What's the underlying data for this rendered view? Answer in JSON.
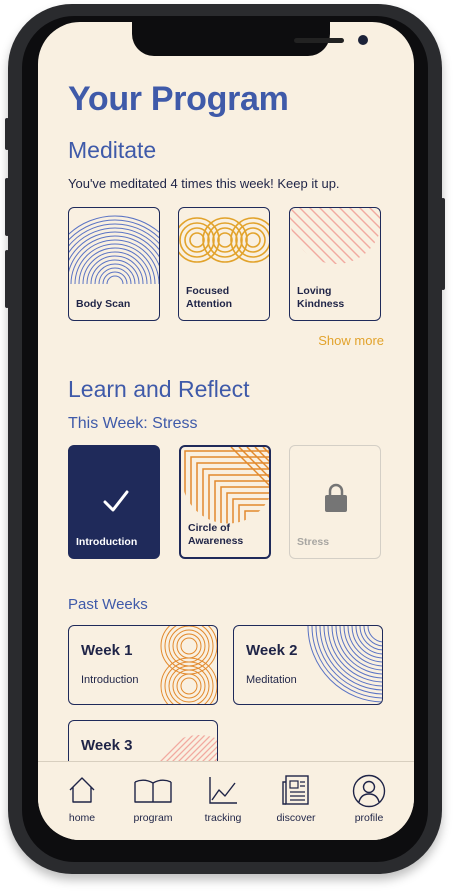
{
  "page": {
    "title": "Your Program"
  },
  "meditate": {
    "heading": "Meditate",
    "message": "You've meditated 4 times this week! Keep it up.",
    "cards": [
      {
        "label": "Body Scan"
      },
      {
        "label": "Focused\nAttention"
      },
      {
        "label": "Loving\nKindness"
      }
    ],
    "show_more": "Show more"
  },
  "learn": {
    "heading": "Learn and Reflect",
    "subheading": "This Week: Stress",
    "cards": [
      {
        "label": "Introduction",
        "state": "completed"
      },
      {
        "label": "Circle of\nAwareness",
        "state": "current"
      },
      {
        "label": "Stress",
        "state": "locked"
      }
    ]
  },
  "past_weeks": {
    "heading": "Past Weeks",
    "weeks": [
      {
        "title": "Week 1",
        "subtitle": "Introduction"
      },
      {
        "title": "Week 2",
        "subtitle": "Meditation"
      },
      {
        "title": "Week 3",
        "subtitle": ""
      }
    ]
  },
  "tabbar": {
    "items": [
      {
        "label": "home",
        "icon": "house-icon"
      },
      {
        "label": "program",
        "icon": "open-book-icon"
      },
      {
        "label": "tracking",
        "icon": "line-chart-icon"
      },
      {
        "label": "discover",
        "icon": "newspaper-icon"
      },
      {
        "label": "profile",
        "icon": "person-icon"
      }
    ]
  },
  "colors": {
    "background": "#f9f0e1",
    "accent_blue": "#3f5aa9",
    "navy": "#1f2a5a",
    "orange": "#e2a32c",
    "pink": "#f2a9a0"
  }
}
